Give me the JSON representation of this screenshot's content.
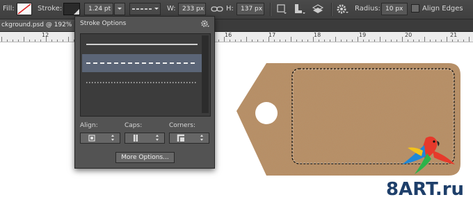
{
  "toolbar": {
    "fill_label": "Fill:",
    "stroke_label": "Stroke:",
    "stroke_width": "1.24 pt",
    "width_label": "W:",
    "width_value": "233 px",
    "height_label": "H:",
    "height_value": "137 px",
    "radius_label": "Radius:",
    "radius_value": "10 px",
    "align_edges_label": "Align Edges",
    "align_edges_checked": false
  },
  "document": {
    "tab_title": "ckground.psd @ 192%"
  },
  "ruler": {
    "numbers": [
      "12",
      "16",
      "17",
      "18",
      "19",
      "20",
      "21"
    ]
  },
  "stroke_panel": {
    "title": "Stroke Options",
    "presets": [
      "solid",
      "dashed",
      "dotted"
    ],
    "selected_preset": "dashed",
    "align_label": "Align:",
    "caps_label": "Caps:",
    "corners_label": "Corners:",
    "more_options_label": "More Options..."
  },
  "watermark": {
    "text": "8ART.ru"
  },
  "colors": {
    "tag": "#b78d63",
    "selected_row": "#5b6577",
    "logo_text": "#1e3f6a"
  }
}
